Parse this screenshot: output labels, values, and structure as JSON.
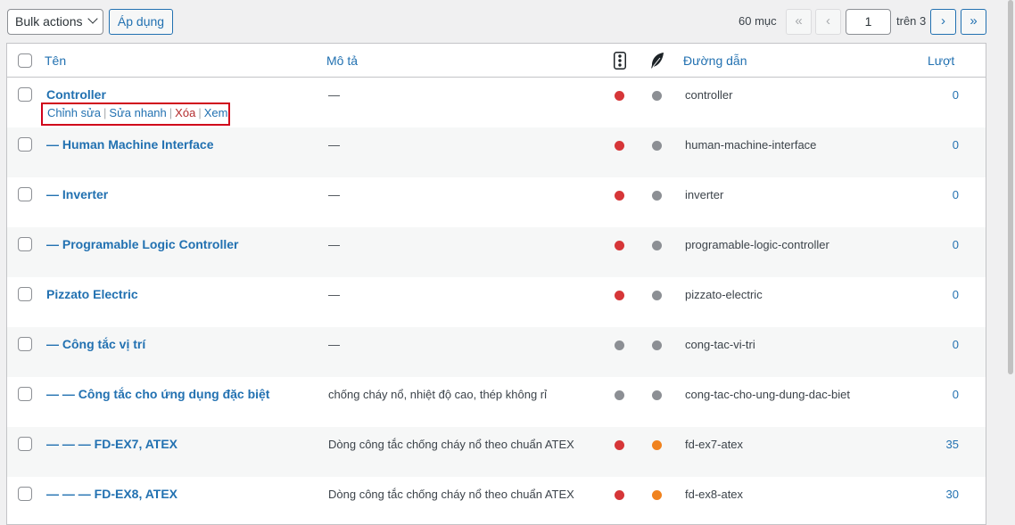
{
  "toolbar": {
    "bulk_actions": "Bulk actions",
    "apply": "Áp dụng",
    "item_count": "60 mục",
    "first": "«",
    "prev": "‹",
    "current_page": "1",
    "of_pages": "trên 3",
    "next": "›",
    "last": "»"
  },
  "columns": {
    "name": "Tên",
    "description": "Mô tả",
    "slug": "Đường dẫn",
    "count": "Lượt"
  },
  "row_actions": {
    "edit": "Chỉnh sửa",
    "quick_edit": "Sửa nhanh",
    "delete": "Xóa",
    "view": "Xem"
  },
  "status_colors": {
    "red": "#d63638",
    "gray": "#8c8f94",
    "orange": "#f0821e"
  },
  "rows": [
    {
      "name": "Controller",
      "description": "—",
      "dot1": "red",
      "dot2": "gray",
      "slug": "controller",
      "count": "0"
    },
    {
      "name": "— Human Machine Interface",
      "description": "—",
      "dot1": "red",
      "dot2": "gray",
      "slug": "human-machine-interface",
      "count": "0"
    },
    {
      "name": "— Inverter",
      "description": "—",
      "dot1": "red",
      "dot2": "gray",
      "slug": "inverter",
      "count": "0"
    },
    {
      "name": "— Programable Logic Controller",
      "description": "—",
      "dot1": "red",
      "dot2": "gray",
      "slug": "programable-logic-controller",
      "count": "0"
    },
    {
      "name": "Pizzato Electric",
      "description": "—",
      "dot1": "red",
      "dot2": "gray",
      "slug": "pizzato-electric",
      "count": "0"
    },
    {
      "name": "— Công tắc vị trí",
      "description": "—",
      "dot1": "gray",
      "dot2": "gray",
      "slug": "cong-tac-vi-tri",
      "count": "0"
    },
    {
      "name": "— — Công tắc cho ứng dụng đặc biệt",
      "description": "chống cháy nổ, nhiệt độ cao, thép không rỉ",
      "dot1": "gray",
      "dot2": "gray",
      "slug": "cong-tac-cho-ung-dung-dac-biet",
      "count": "0"
    },
    {
      "name": "— — — FD-EX7, ATEX",
      "description": "Dòng công tắc chống cháy nổ theo chuẩn ATEX",
      "dot1": "red",
      "dot2": "orange",
      "slug": "fd-ex7-atex",
      "count": "35"
    },
    {
      "name": "— — — FD-EX8, ATEX",
      "description": "Dòng công tắc chống cháy nổ theo chuẩn ATEX",
      "dot1": "red",
      "dot2": "orange",
      "slug": "fd-ex8-atex",
      "count": "30"
    }
  ]
}
